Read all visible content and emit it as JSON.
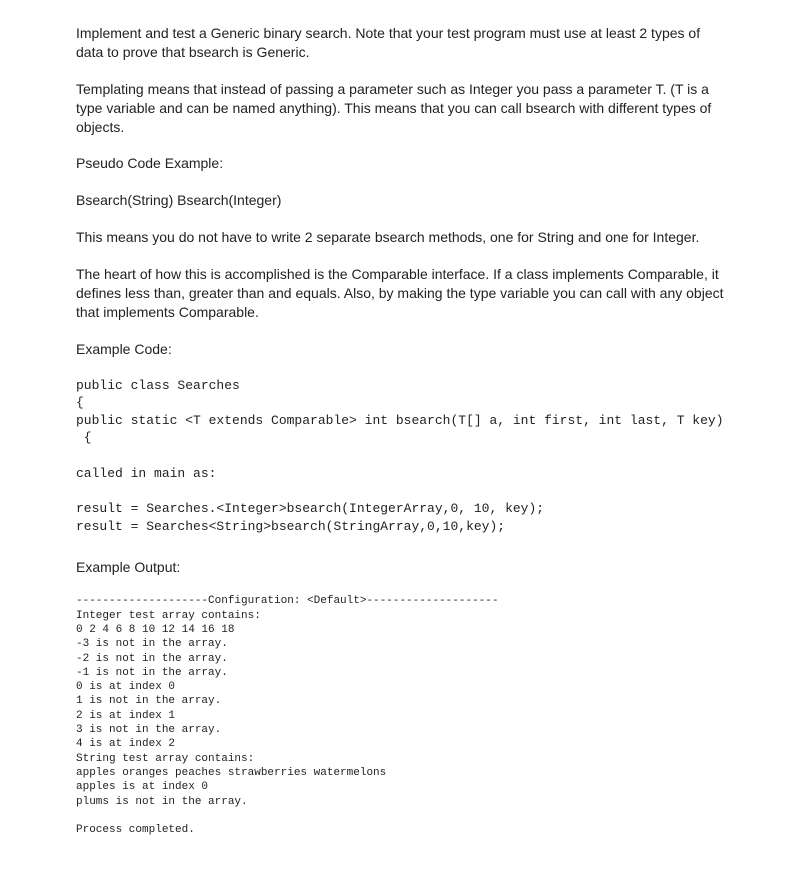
{
  "p1": "Implement and test a Generic binary search.  Note that your test program must use at least 2 types of data to prove that bsearch is Generic.",
  "p2": "Templating means that instead of passing a parameter such as Integer you pass a parameter T. (T is a type variable and can be named anything).  This means that you can call bsearch with different types of objects.",
  "p3": "Pseudo Code Example:",
  "p4": "Bsearch(String)  Bsearch(Integer)",
  "p5": "This means you do not have to write 2 separate bsearch methods, one for String and one for Integer.",
  "p6": "The heart of how this  is accomplished is the Comparable interface.  If a class implements Comparable, it defines less than, greater than and equals. Also, by making the type variable you can call with any object that implements Comparable.",
  "p7": "Example Code:",
  "code1": "public class Searches\n{\npublic static <T extends Comparable> int bsearch(T[] a, int first, int last, T key)\n {",
  "code2": "called in main as:",
  "code3": "result = Searches.<Integer>bsearch(IntegerArray,0, 10, key);\nresult = Searches<String>bsearch(StringArray,0,10,key);",
  "p8": "Example Output:",
  "out1": "--------------------Configuration: <Default>--------------------\nInteger test array contains:\n0 2 4 6 8 10 12 14 16 18\n-3 is not in the array.\n-2 is not in the array.\n-1 is not in the array.\n0 is at index 0\n1 is not in the array.\n2 is at index 1\n3 is not in the array.\n4 is at index 2\nString test array contains:\napples oranges peaches strawberries watermelons\napples is at index 0\nplums is not in the array.",
  "out2": "Process completed."
}
